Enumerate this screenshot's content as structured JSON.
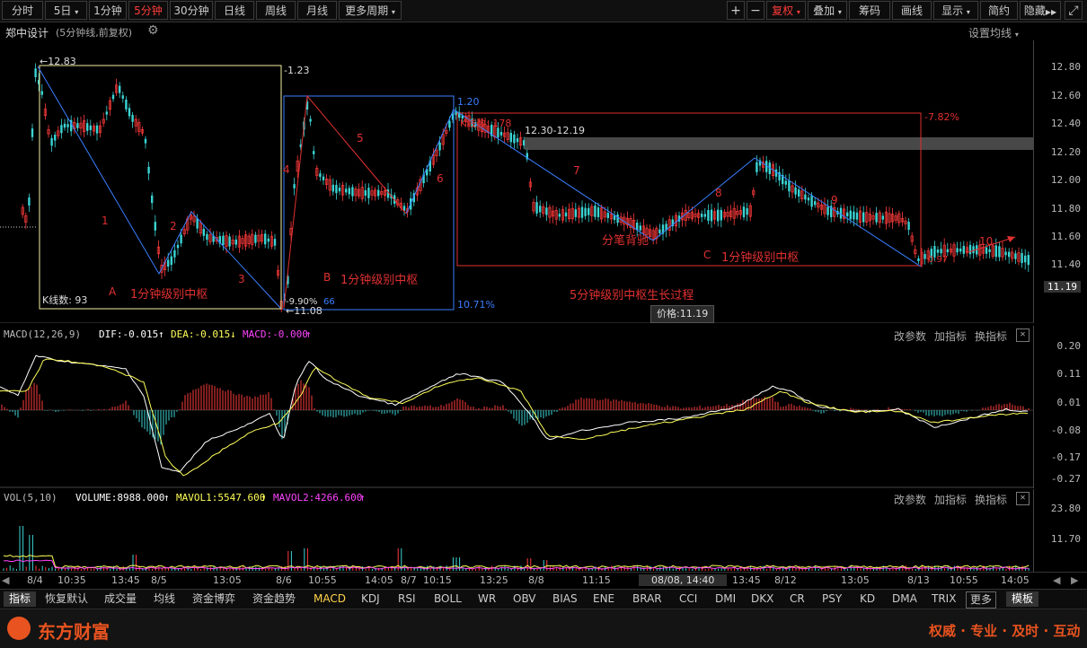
{
  "toolbar": {
    "left": [
      "分时",
      "5日",
      "1分钟",
      "5分钟",
      "30分钟",
      "日线",
      "周线",
      "月线",
      "更多周期"
    ],
    "active": "5分钟",
    "right": [
      "复权",
      "叠加",
      "筹码",
      "画线",
      "显示",
      "简约",
      "隐藏"
    ]
  },
  "title": {
    "name": "郑中设计",
    "sub": "(5分钟线,前复权)",
    "ma_setting": "设置均线"
  },
  "price_axis": [
    "12.80",
    "12.60",
    "12.40",
    "12.20",
    "12.00",
    "11.80",
    "11.60",
    "11.40",
    "11.19"
  ],
  "annotations": {
    "high": "12.83",
    "low": "11.08",
    "r1": "-1.23",
    "r2": "1.20",
    "r3": "-7.82%",
    "r4": "10.71%",
    "pct1": "-9.90%",
    "pct2": "66",
    "pct3": "0.97",
    "kcount1": "K线数: 93",
    "kcount2": "K线数: 178",
    "range": "12.30-12.19",
    "n1": "1",
    "n2": "2",
    "n3": "3",
    "n4": "4",
    "n5": "5",
    "n6": "6",
    "n7": "7",
    "n8": "8",
    "n9": "9",
    "n10": "10",
    "zA": "A",
    "zA_text": "1分钟级别中枢",
    "zB": "B",
    "zB_text": "1分钟级别中枢",
    "zC": "C",
    "zC_text": "1分钟级别中枢",
    "divergence": "分笔背驰",
    "process": "5分钟级别中枢生长过程",
    "price_tip": "价格:11.19"
  },
  "macd": {
    "label": "MACD(12,26,9)",
    "dif": "DIF:-0.015",
    "dea": "DEA:-0.015",
    "macd": "MACD:-0.000",
    "axis": [
      "0.20",
      "0.11",
      "0.01",
      "-0.08",
      "-0.17",
      "-0.27"
    ]
  },
  "vol": {
    "label": "VOL(5,10)",
    "volume": "VOLUME:8988.000",
    "mavol1": "MAVOL1:5547.600",
    "mavol2": "MAVOL2:4266.600",
    "axis": [
      "23.80",
      "11.70"
    ]
  },
  "panel_buttons": [
    "改参数",
    "加指标",
    "换指标"
  ],
  "time_axis": [
    "8/4",
    "10:35",
    "13:45",
    "8/5",
    "13:05",
    "8/6",
    "10:55",
    "14:05",
    "8/7",
    "10:15",
    "13:25",
    "8/8",
    "11:15",
    "08/08, 14:40",
    "13:45",
    "8/12",
    "13:05",
    "8/13",
    "10:55",
    "14:05"
  ],
  "tabs": [
    "指标",
    "恢复默认",
    "成交量",
    "均线",
    "资金博弈",
    "资金趋势",
    "MACD",
    "KDJ",
    "RSI",
    "BOLL",
    "WR",
    "OBV",
    "BIAS",
    "ENE",
    "BRAR",
    "CCI",
    "DMI",
    "DKX",
    "CR",
    "PSY",
    "KD",
    "DMA",
    "TRIX",
    "更多",
    "模板"
  ],
  "footer": {
    "brand": "东方财富",
    "slogan": "权威 · 专业 · 及时 · 互动"
  },
  "colors": {
    "up": "#ff3b3b",
    "down": "#3bd4d4",
    "dif": "#ffffff",
    "dea": "#ffff5a",
    "macd": "#ff44ff",
    "box_yellow": "#f4f0a0",
    "box_blue": "#3a7fff",
    "box_red": "#e03030"
  }
}
